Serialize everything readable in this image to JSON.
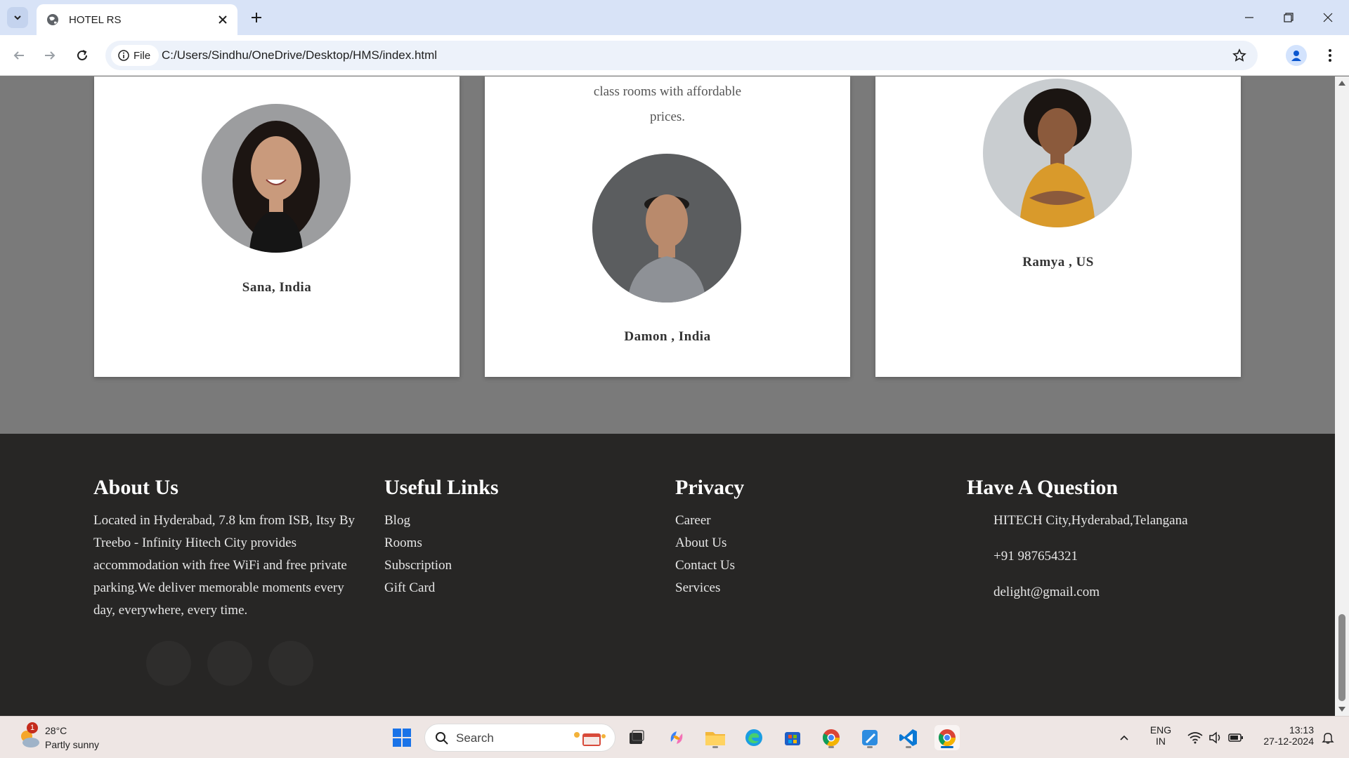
{
  "browser": {
    "tab_title": "HOTEL RS",
    "file_chip": "File",
    "url": "C:/Users/Sindhu/OneDrive/Desktop/HMS/index.html"
  },
  "testimonials": [
    {
      "name": "Sana, India",
      "text": []
    },
    {
      "name": "Damon , India",
      "text": [
        "class rooms with affordable",
        "prices."
      ]
    },
    {
      "name": "Ramya , US",
      "text": []
    }
  ],
  "footer": {
    "about": {
      "heading": "About Us",
      "body": "Located in Hyderabad, 7.8 km from ISB, Itsy By Treebo - Infinity Hitech City provides accommodation with free WiFi and free private parking.We deliver memorable moments every day, everywhere, every time."
    },
    "useful_links": {
      "heading": "Useful Links",
      "items": [
        "Blog",
        "Rooms",
        "Subscription",
        "Gift Card"
      ]
    },
    "privacy": {
      "heading": "Privacy",
      "items": [
        "Career",
        "About Us",
        "Contact Us",
        "Services"
      ]
    },
    "question": {
      "heading": "Have A Question",
      "address": "HITECH City,Hyderabad,Telangana",
      "phone": "+91 987654321",
      "email": "delight@gmail.com"
    }
  },
  "taskbar": {
    "weather_temp": "28°C",
    "weather_cond": "Partly sunny",
    "weather_badge": "1",
    "search_label": "Search",
    "lang_line1": "ENG",
    "lang_line2": "IN",
    "time": "13:13",
    "date": "27-12-2024"
  }
}
